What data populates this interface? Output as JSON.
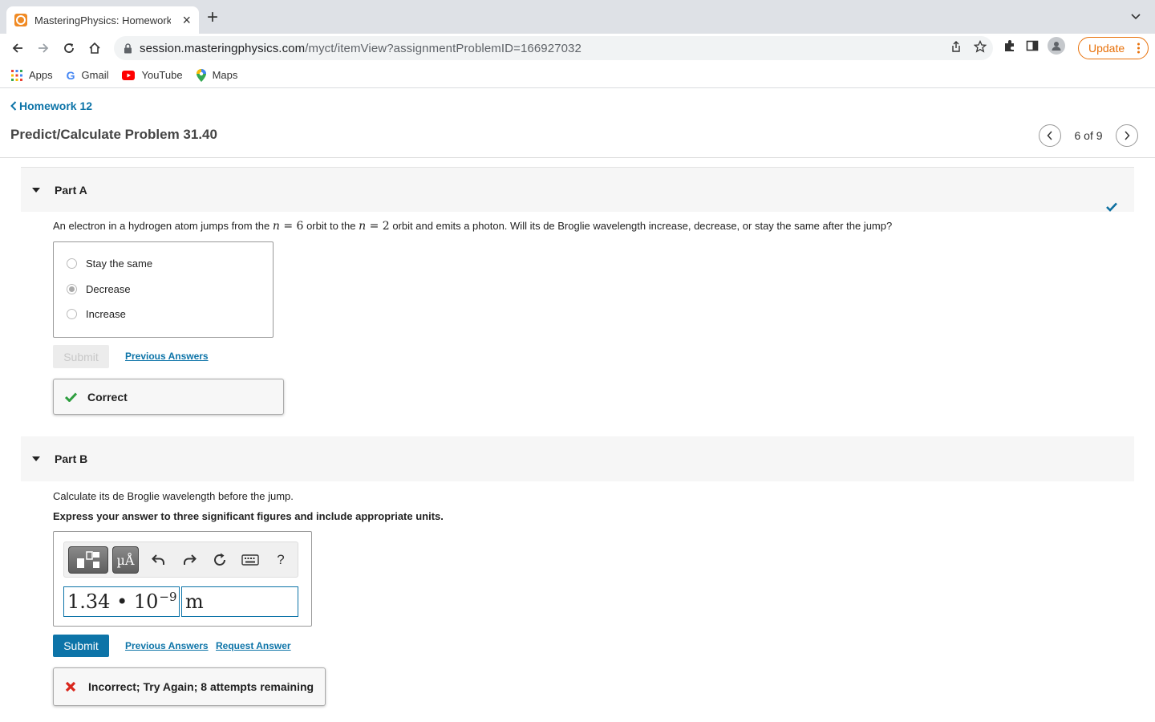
{
  "browser": {
    "tab_title": "MasteringPhysics: Homework 12",
    "url_host": "session.masteringphysics.com",
    "url_path": "/myct/itemView?assignmentProblemID=166927032",
    "update_label": "Update",
    "bookmarks": [
      {
        "label": "Apps",
        "icon": "apps-grid-icon"
      },
      {
        "label": "Gmail",
        "icon": "google-g-icon"
      },
      {
        "label": "YouTube",
        "icon": "youtube-icon"
      },
      {
        "label": "Maps",
        "icon": "maps-pin-icon"
      }
    ]
  },
  "header": {
    "back_label": "Homework 12",
    "problem_title": "Predict/Calculate Problem 31.40",
    "pager_text": "6 of 9"
  },
  "part_a": {
    "label": "Part A",
    "question_pre": "An electron in a hydrogen atom jumps from the ",
    "question_mid1": " orbit to the ",
    "question_post": " orbit and emits a photon. Will its de Broglie wavelength increase, decrease, or stay the same after the jump?",
    "n1": "6",
    "n2": "2",
    "choices": [
      "Stay the same",
      "Decrease",
      "Increase"
    ],
    "selected": "Decrease",
    "submit_label": "Submit",
    "previous_answers": "Previous Answers",
    "feedback": "Correct",
    "status": "complete"
  },
  "part_b": {
    "label": "Part B",
    "question": "Calculate its de Broglie wavelength before the jump.",
    "instruction": "Express your answer to three significant figures and include appropriate units.",
    "toolbar": {
      "templates": "templates-icon",
      "units": "µÅ",
      "undo": "undo-icon",
      "redo": "redo-icon",
      "reset": "reset-icon",
      "keyboard": "keyboard-icon",
      "help": "?"
    },
    "value_mantissa": "1.34 • 10",
    "value_exponent": "−9",
    "unit_value": "m",
    "submit_label": "Submit",
    "previous_answers": "Previous Answers",
    "request_answer": "Request Answer",
    "feedback": "Incorrect; Try Again; 8 attempts remaining"
  },
  "colors": {
    "link_blue": "#0d74a8",
    "correct_green": "#2e9e3f",
    "incorrect_red": "#d9261c",
    "update_orange": "#e8710a"
  }
}
